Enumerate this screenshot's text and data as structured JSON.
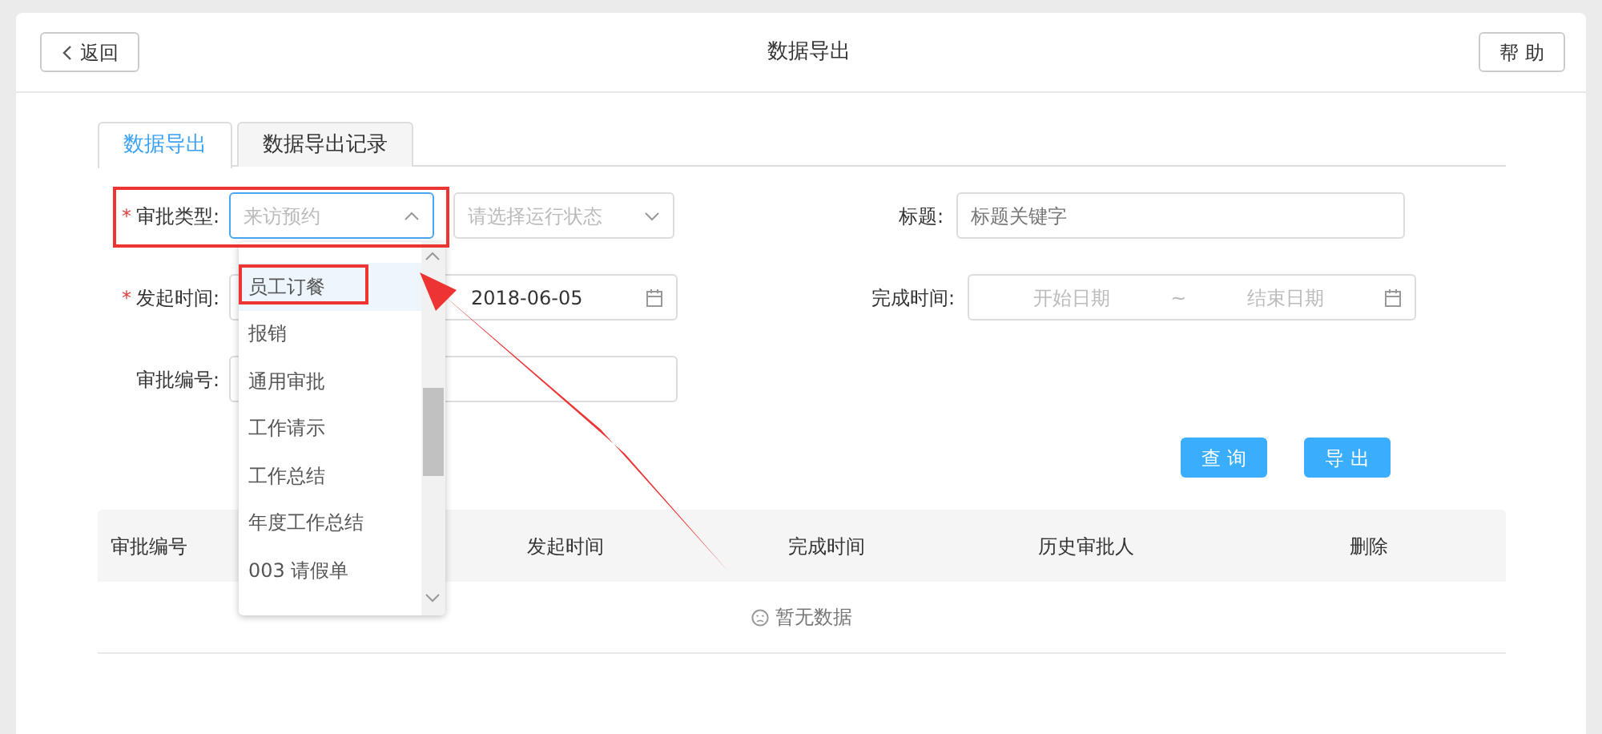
{
  "header": {
    "back_button": "返回",
    "title": "数据导出",
    "help_button": "帮 助"
  },
  "tabs": [
    {
      "label": "数据导出",
      "selected": true
    },
    {
      "label": "数据导出记录",
      "selected": false
    }
  ],
  "form": {
    "approval_type": {
      "required_mark": "*",
      "label": "审批类型:",
      "value": "来访预约",
      "expanded": true
    },
    "run_status": {
      "placeholder": "请选择运行状态"
    },
    "title": {
      "label": "标题:",
      "placeholder": "标题关键字"
    },
    "start_time": {
      "required_mark": "*",
      "label": "发起时间:",
      "value": "2018-06-05"
    },
    "finish_time": {
      "label": "完成时间:",
      "start_placeholder": "开始日期",
      "separator": "~",
      "end_placeholder": "结束日期"
    },
    "approval_no": {
      "label": "审批编号:"
    },
    "buttons": [
      {
        "label": "查 询"
      },
      {
        "label": "导 出"
      }
    ]
  },
  "table": {
    "columns": [
      "审批编号",
      "发起时间",
      "完成时间",
      "历史审批人",
      "删除"
    ],
    "empty_text": "暂无数据"
  },
  "dropdown": {
    "items": [
      {
        "label": "员工订餐",
        "selected": true
      },
      {
        "label": "报销",
        "selected": false
      },
      {
        "label": "通用审批",
        "selected": false
      },
      {
        "label": "工作请示",
        "selected": false
      },
      {
        "label": "工作总结",
        "selected": false
      },
      {
        "label": "年度工作总结",
        "selected": false
      },
      {
        "label": "003 请假单",
        "selected": false
      }
    ]
  }
}
